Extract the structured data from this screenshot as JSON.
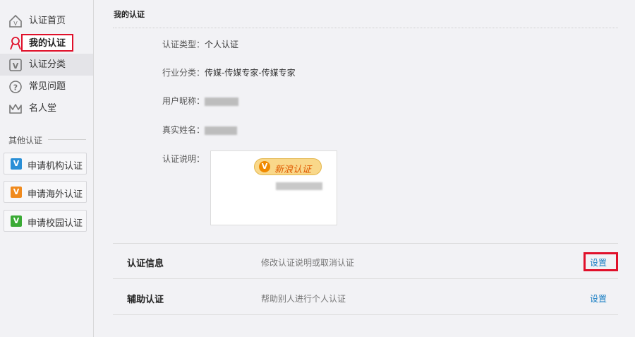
{
  "sidebar": {
    "items": [
      {
        "label": "认证首页",
        "icon": "home-v-icon"
      },
      {
        "label": "我的认证",
        "icon": "ribbon-icon"
      },
      {
        "label": "认证分类",
        "icon": "v-box-icon"
      },
      {
        "label": "常见问题",
        "icon": "question-icon"
      },
      {
        "label": "名人堂",
        "icon": "crown-icon"
      }
    ],
    "other_heading": "其他认证",
    "apply": [
      {
        "label": "申请机构认证",
        "badge": "V",
        "color": "#2a8fd6"
      },
      {
        "label": "申请海外认证",
        "badge": "V",
        "color": "#f08a1d"
      },
      {
        "label": "申请校园认证",
        "badge": "V",
        "color": "#3aaa35"
      }
    ]
  },
  "main": {
    "title": "我的认证",
    "fields": {
      "type_label": "认证类型：",
      "type_value": "个人认证",
      "industry_label": "行业分类：",
      "industry_value": "传媒-传媒专家-传媒专家",
      "nickname_label": "用户昵称：",
      "realname_label": "真实姓名：",
      "desc_label": "认证说明："
    },
    "badge_text": "新浪认证",
    "rows": [
      {
        "title": "认证信息",
        "desc": "修改认证说明或取消认证",
        "link": "设置"
      },
      {
        "title": "辅助认证",
        "desc": "帮助别人进行个人认证",
        "link": "设置"
      }
    ]
  },
  "colors": {
    "highlight_red": "#e0102a",
    "link_blue": "#1a7fc4"
  }
}
